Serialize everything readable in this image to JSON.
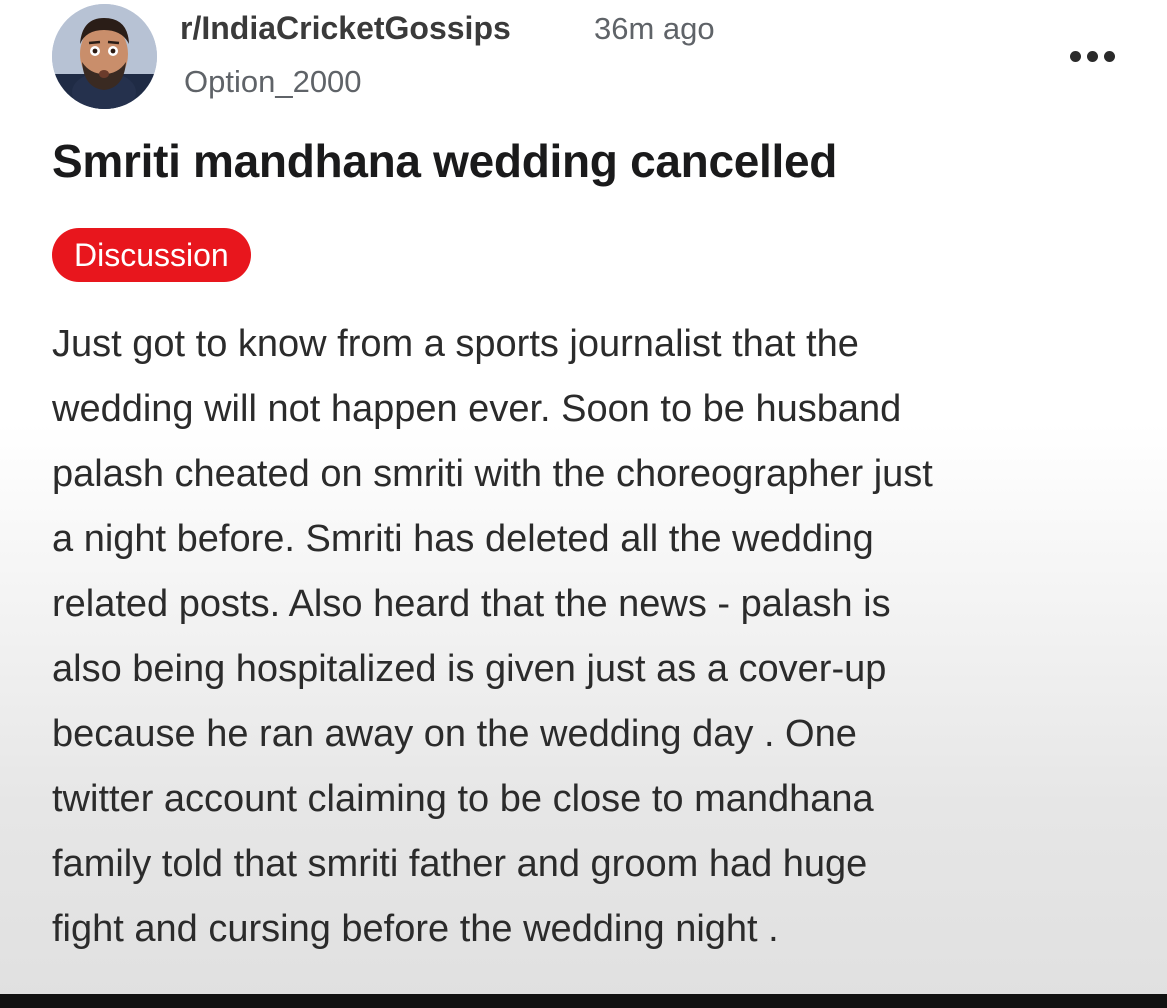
{
  "post": {
    "subreddit": "r/IndiaCricketGossips",
    "time_ago": "36m ago",
    "author": "Option_2000",
    "title": "Smriti mandhana wedding cancelled",
    "flair": "Discussion",
    "flair_color": "#e8161d",
    "body": "Just got to know from a sports journalist that the\nwedding will not happen ever. Soon to be husband\npalash cheated on smriti with the choreographer just\na night before. Smriti has deleted all the wedding\nrelated posts. Also heard that the news - palash is\nalso being hospitalized is given just as a cover-up\nbecause he ran away on the wedding day . One\ntwitter account claiming to be close to mandhana\nfamily told that smriti father and groom had huge\nfight and cursing before the wedding night .",
    "more_options_icon": "more-horizontal-icon",
    "avatar_icon": "user-avatar"
  }
}
